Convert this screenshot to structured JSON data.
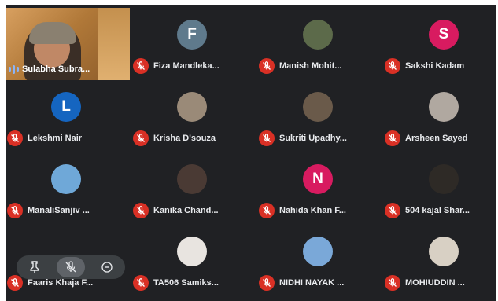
{
  "self": {
    "name": "Sulabha Subra..."
  },
  "participants": [
    {
      "name": "Fiza Mandleka...",
      "avatar": {
        "kind": "letter",
        "letter": "F",
        "color": "#5f7a8c"
      }
    },
    {
      "name": "Manish Mohit...",
      "avatar": {
        "kind": "photo",
        "color": "#5c6a4a"
      }
    },
    {
      "name": "Sakshi Kadam",
      "avatar": {
        "kind": "letter",
        "letter": "S",
        "color": "#d81b60"
      }
    },
    {
      "name": "Lekshmi Nair",
      "avatar": {
        "kind": "letter",
        "letter": "L",
        "color": "#1565c0"
      }
    },
    {
      "name": "Krisha D'souza",
      "avatar": {
        "kind": "photo",
        "color": "#9a8a78"
      }
    },
    {
      "name": "Sukriti Upadhy...",
      "avatar": {
        "kind": "photo",
        "color": "#6a5a4a"
      }
    },
    {
      "name": "Arsheen Sayed",
      "avatar": {
        "kind": "photo",
        "color": "#b0a8a0"
      }
    },
    {
      "name": "ManaliSanjiv ...",
      "avatar": {
        "kind": "photo",
        "color": "#6fa8d8"
      }
    },
    {
      "name": "Kanika Chand...",
      "avatar": {
        "kind": "photo",
        "color": "#4a3a34"
      }
    },
    {
      "name": "Nahida Khan F...",
      "avatar": {
        "kind": "letter",
        "letter": "N",
        "color": "#d81b60"
      }
    },
    {
      "name": "504 kajal Shar...",
      "avatar": {
        "kind": "photo",
        "color": "#2e2a26"
      }
    },
    {
      "name": "Faaris Khaja F...",
      "avatar": {
        "kind": "none"
      }
    },
    {
      "name": "TA506 Samiks...",
      "avatar": {
        "kind": "photo",
        "color": "#e8e4e0"
      }
    },
    {
      "name": "NIDHI NAYAK ...",
      "avatar": {
        "kind": "photo",
        "color": "#7aa8d8"
      }
    },
    {
      "name": "MOHIUDDIN ...",
      "avatar": {
        "kind": "photo",
        "color": "#d8d0c4"
      }
    }
  ],
  "controls": [
    {
      "icon": "pin-icon"
    },
    {
      "icon": "mic-off-icon"
    },
    {
      "icon": "remove-icon"
    }
  ],
  "colors": {
    "background": "#202124",
    "mic_muted": "#d93025",
    "name_text": "#e8eaed"
  }
}
